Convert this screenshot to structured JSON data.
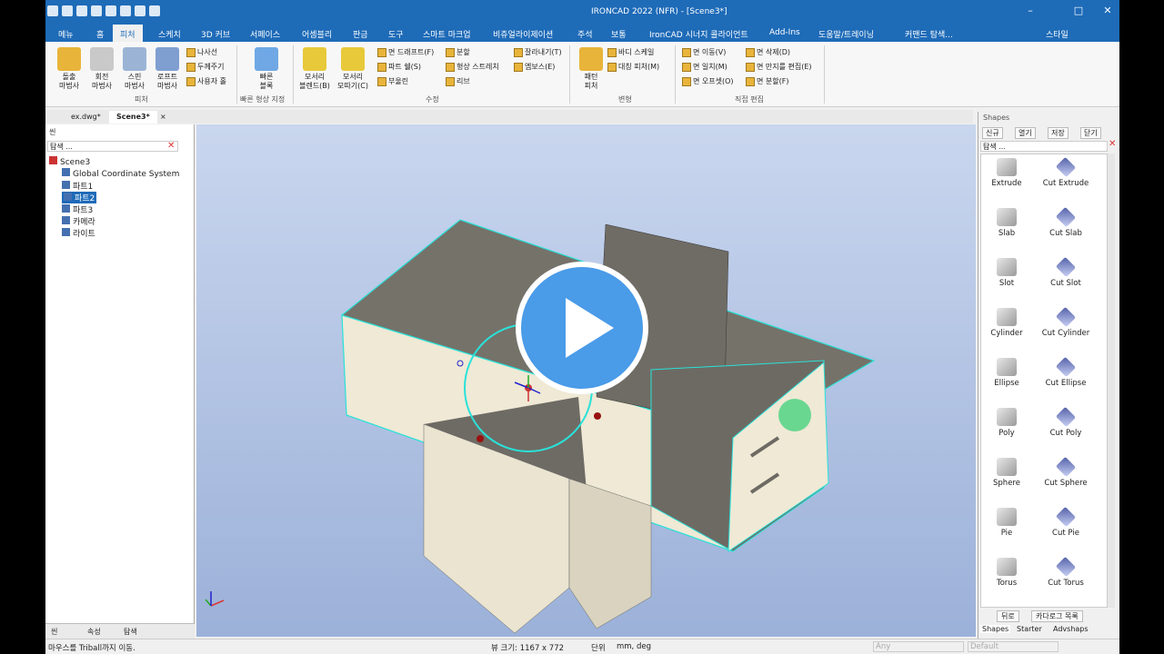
{
  "window": {
    "title": "IRONCAD 2022 (NFR) - [Scene3*]",
    "help": "?"
  },
  "menu": {
    "items": [
      "메뉴",
      "홈",
      "피처",
      "스케치",
      "3D 커브",
      "서페이스",
      "어셈블리",
      "판금",
      "도구",
      "스마트 마크업",
      "비쥬얼라이제이션",
      "주석",
      "보통",
      "IronCAD 시너지 콜라이언트",
      "Add-Ins",
      "도움말/트레이닝",
      "커맨드 탐색...",
      "스타일"
    ]
  },
  "ribbon": {
    "big": [
      {
        "label": "돌출\n마법사"
      },
      {
        "label": "회전\n마법사"
      },
      {
        "label": "스핀\n마법사"
      },
      {
        "label": "로프트\n마법사"
      },
      {
        "label": "빠른\n블록"
      },
      {
        "label": "모서리\n블렌드(B)"
      },
      {
        "label": "모서리\n모따기(C)"
      },
      {
        "label": "패턴\n피처"
      }
    ],
    "small": [
      "나사선",
      "두께주기",
      "사용자 홀",
      "면 드래프트(F)",
      "파트 쉘(S)",
      "부울린",
      "분할",
      "형상 스트레치",
      "리브",
      "잘라내기(T)",
      "엠보스(E)",
      "바디 스케일",
      "대칭 피처(M)",
      "면 이동(V)",
      "면 일치(M)",
      "면 오프셋(O)",
      "면 삭제(D)",
      "면 만지를 편집(E)",
      "면 분할(F)"
    ],
    "groups": [
      "피처",
      "빠른 형상 지정",
      "수정",
      "변형",
      "직접 편집"
    ]
  },
  "tabs": [
    "ex.dwg*",
    "Scene3*"
  ],
  "scene_panel": {
    "title": "씬",
    "search": "탐색 ...",
    "tree": [
      "Scene3",
      "Global Coordinate System",
      "파트1",
      "파트2",
      "파트3",
      "카메라",
      "라이트"
    ]
  },
  "bottom_tabs": [
    "씬",
    "속성",
    "탐색"
  ],
  "shapes_panel": {
    "title": "Shapes",
    "toolbar": [
      "신규",
      "열기",
      "저장",
      "닫기"
    ],
    "search": "탐색 ...",
    "items": [
      [
        "Extrude",
        "Cut Extrude"
      ],
      [
        "Slab",
        "Cut Slab"
      ],
      [
        "Slot",
        "Cut Slot"
      ],
      [
        "Cylinder",
        "Cut Cylinder"
      ],
      [
        "Ellipse",
        "Cut Ellipse"
      ],
      [
        "Poly",
        "Cut Poly"
      ],
      [
        "Sphere",
        "Cut Sphere"
      ],
      [
        "Pie",
        "Cut Pie"
      ],
      [
        "Torus",
        "Cut Torus"
      ]
    ],
    "nav": [
      "뒤로",
      "카다로그 목록"
    ],
    "tabs": [
      "Shapes",
      "Starter",
      "Advshaps"
    ]
  },
  "status": {
    "message": "마우스를 Triball까지 이동.",
    "view_size": "뷰 크기: 1167 x 772",
    "unit_label": "단위",
    "units": "mm, deg",
    "any": "Any",
    "default": "Default"
  }
}
